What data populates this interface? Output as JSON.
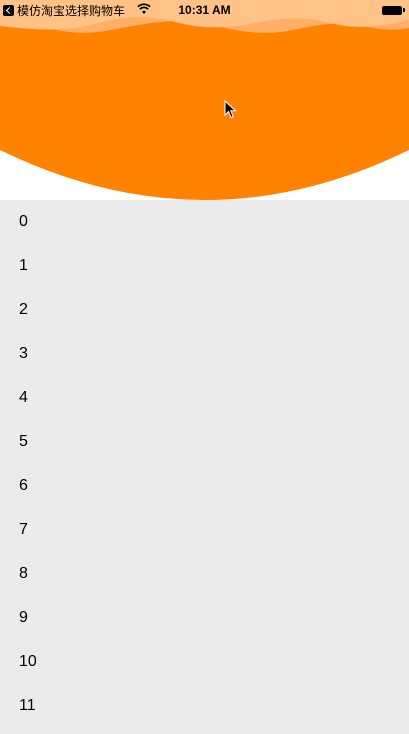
{
  "status_bar": {
    "back_app_label": "模仿淘宝选择购物车",
    "time": "10:31 AM",
    "icons": [
      "back-chevron-icon",
      "wifi-icon",
      "battery-icon"
    ]
  },
  "header": {
    "colors": {
      "orange": "#ff8300",
      "wave_light": "#ffc287",
      "background": "#ffffff"
    }
  },
  "list": {
    "background": "#ebebeb",
    "items": [
      "0",
      "1",
      "2",
      "3",
      "4",
      "5",
      "6",
      "7",
      "8",
      "9",
      "10",
      "11"
    ]
  }
}
